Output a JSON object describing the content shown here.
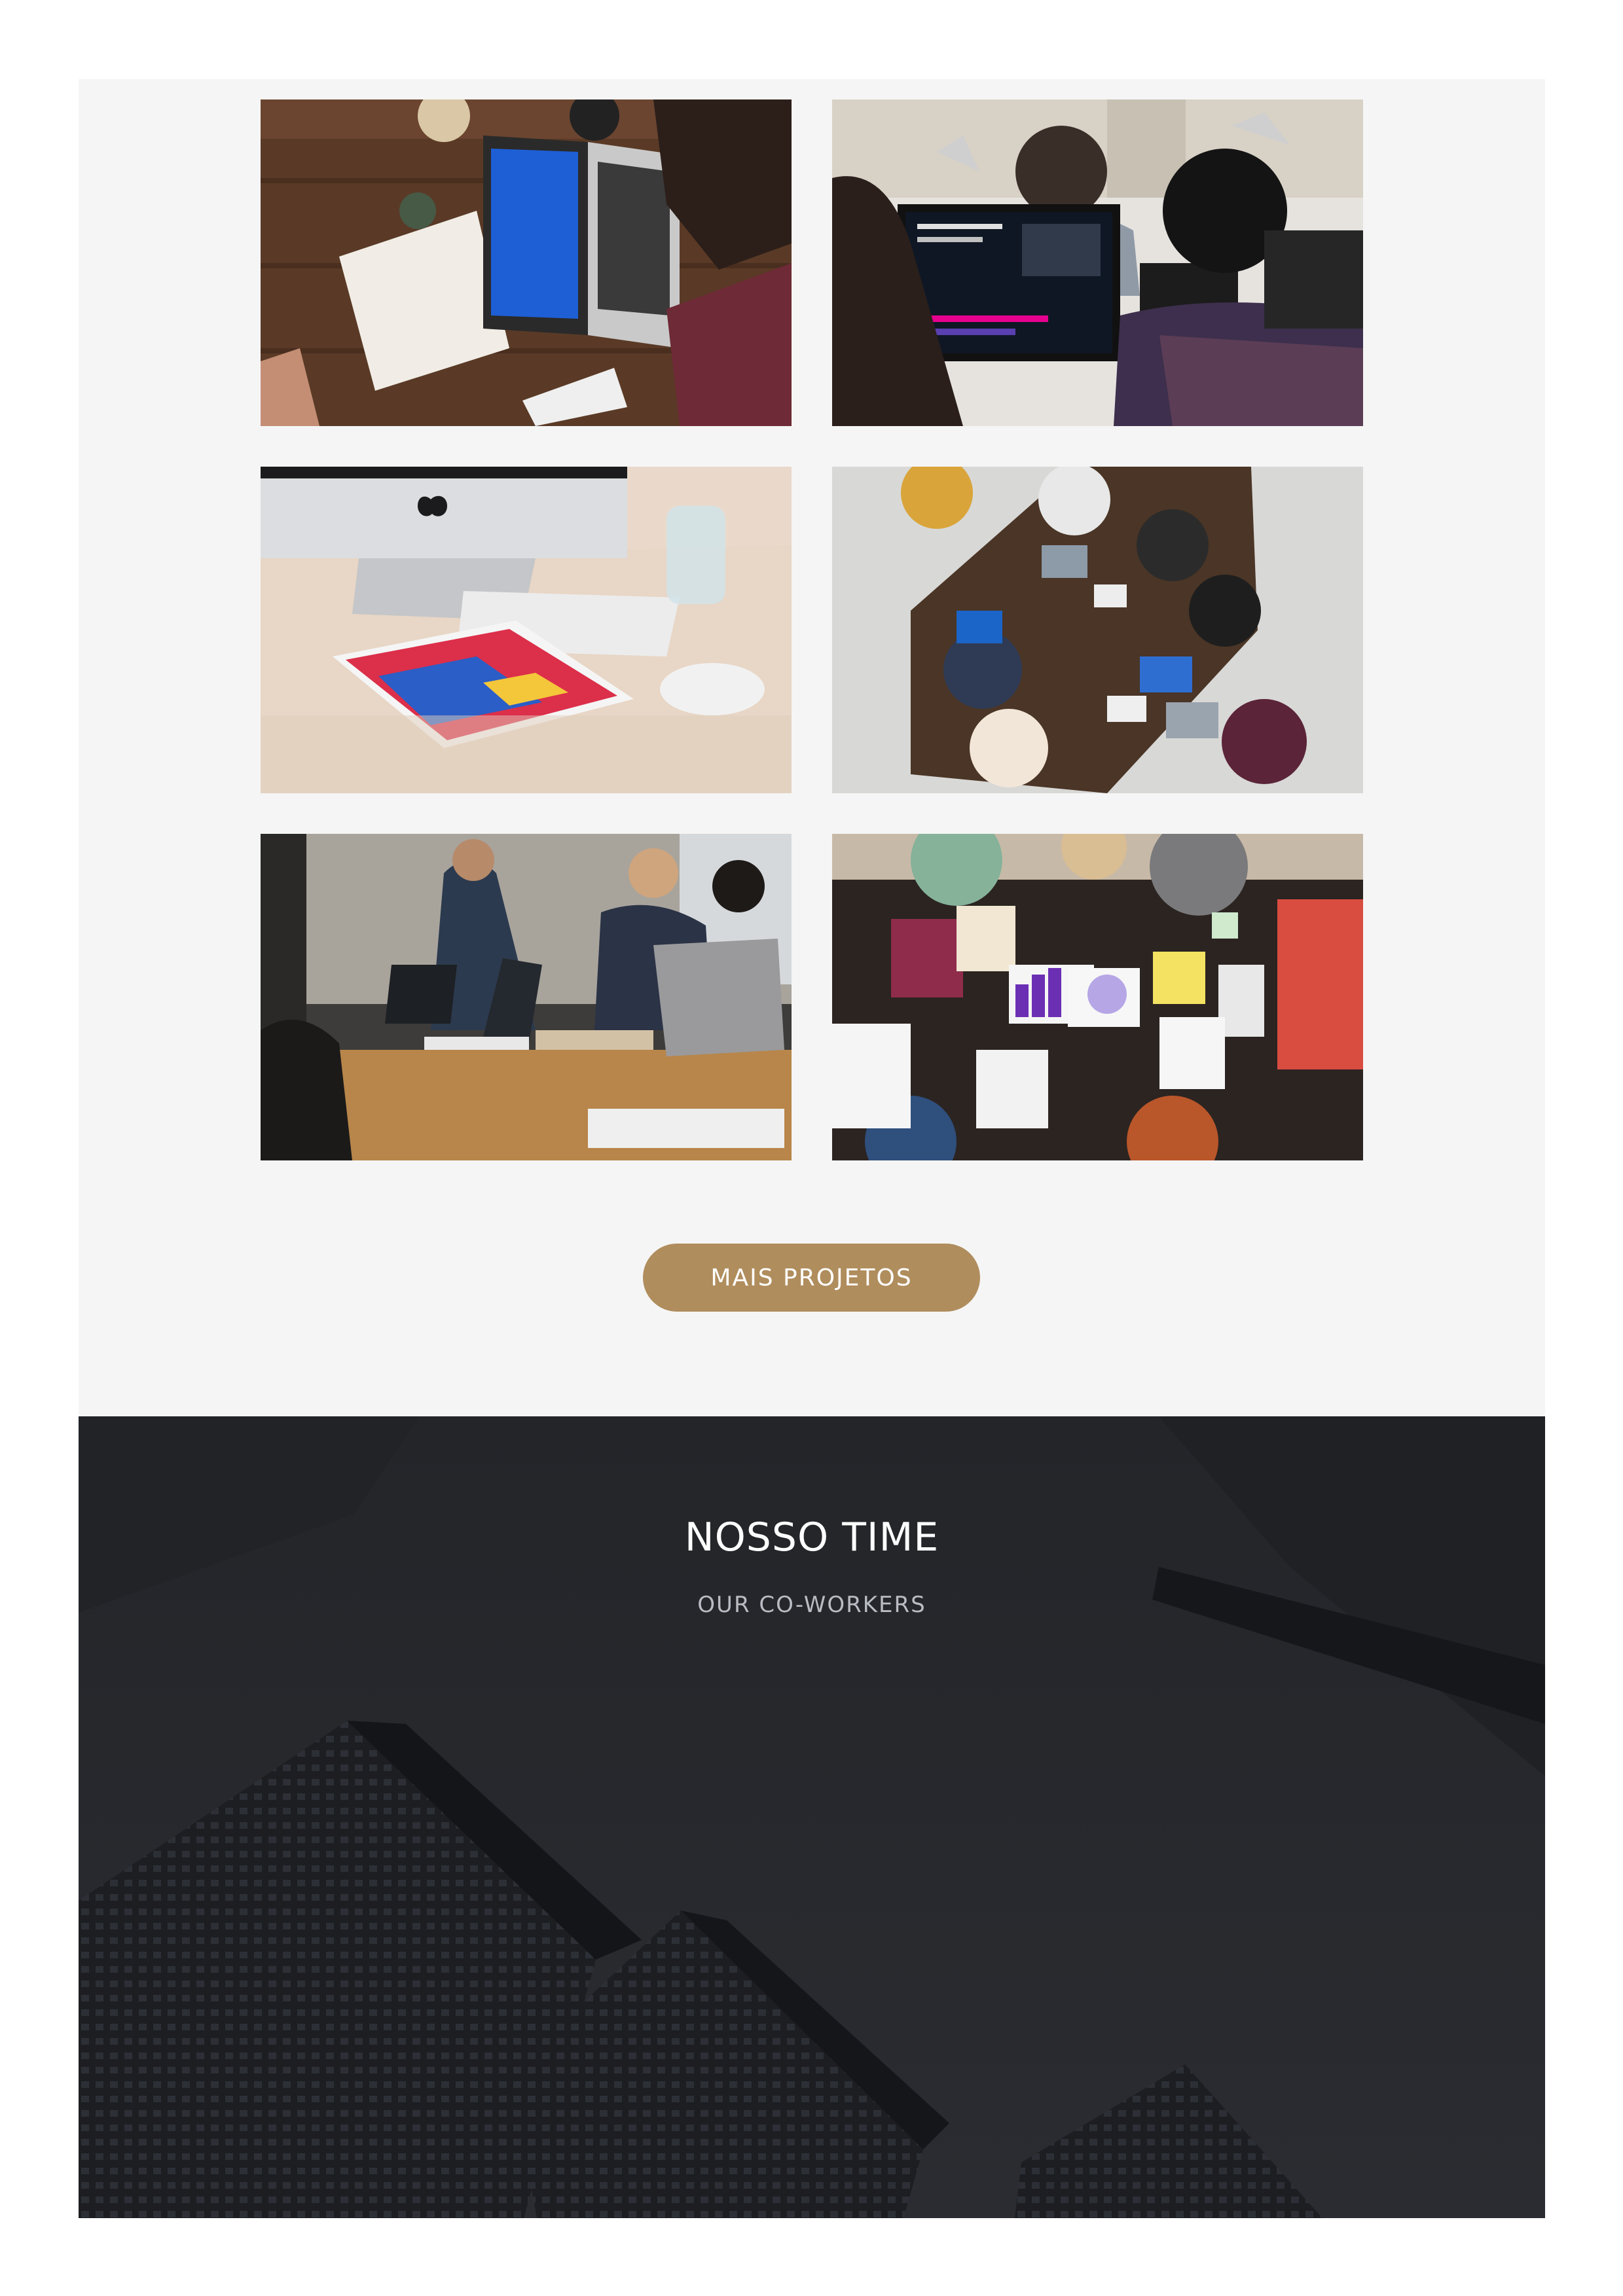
{
  "portfolio": {
    "background_color": "#f5f5f5",
    "images": [
      {
        "subject": "laptop-on-wooden-desk-photo"
      },
      {
        "subject": "developers-at-computer-photo"
      },
      {
        "subject": "imac-and-tablet-on-desk-photo"
      },
      {
        "subject": "team-meeting-top-view-photo"
      },
      {
        "subject": "office-presentation-photo"
      },
      {
        "subject": "business-planning-top-view-photo"
      }
    ],
    "more_button": {
      "label": "MAIS PROJETOS",
      "color": "#b08d5d"
    }
  },
  "team_section": {
    "title": "NOSSO TIME",
    "subtitle": "OUR CO-WORKERS",
    "background": "skyscrapers-photo"
  }
}
